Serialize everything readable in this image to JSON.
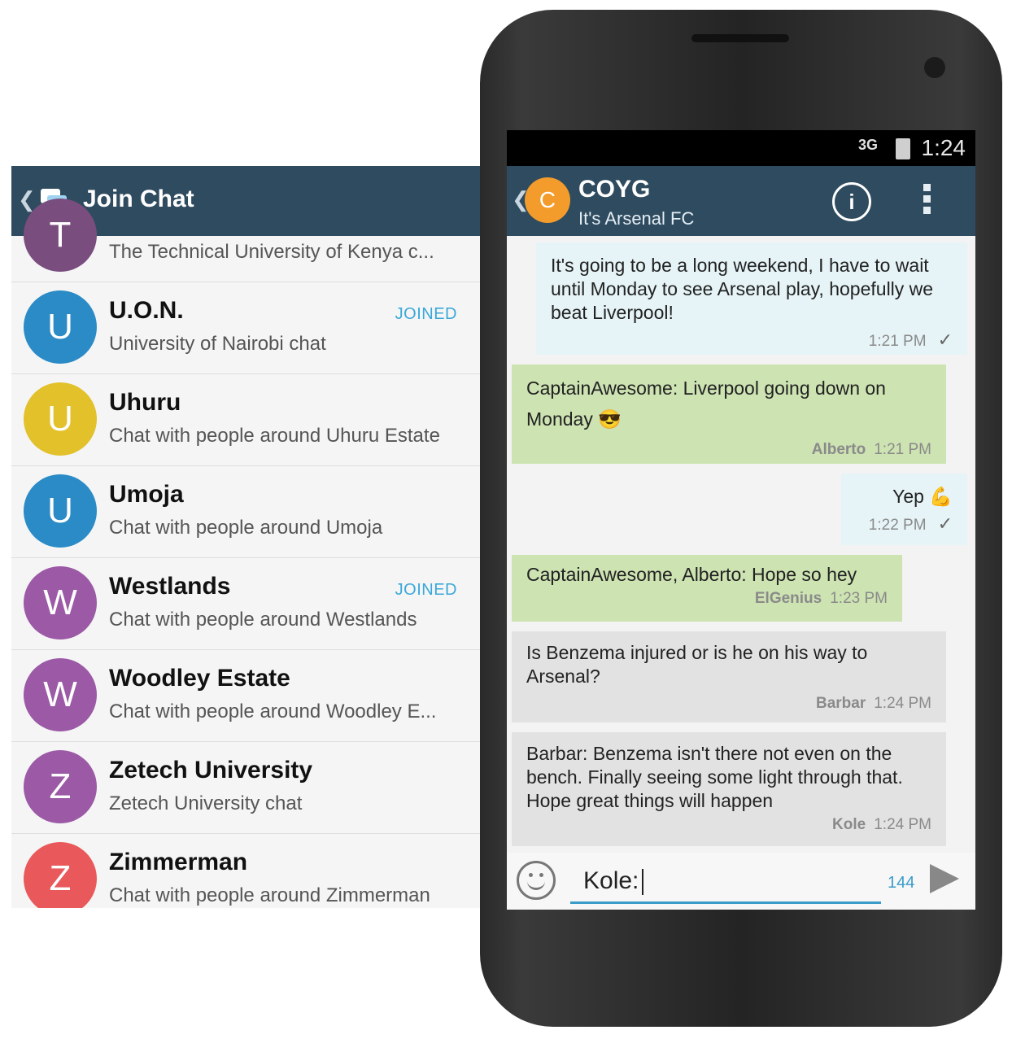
{
  "left": {
    "title": "Join Chat",
    "items": [
      {
        "avatar": "T",
        "name": "",
        "desc": "The Technical University of Kenya c...",
        "badge": "",
        "color": "#7a4d7f"
      },
      {
        "avatar": "U",
        "name": "U.O.N.",
        "desc": "University of Nairobi chat",
        "badge": "JOINED",
        "color": "#2a8bc6"
      },
      {
        "avatar": "U",
        "name": "Uhuru",
        "desc": "Chat with people around Uhuru Estate",
        "badge": "",
        "color": "#e2c12b"
      },
      {
        "avatar": "U",
        "name": "Umoja",
        "desc": "Chat with people around Umoja",
        "badge": "",
        "color": "#2a8bc6"
      },
      {
        "avatar": "W",
        "name": "Westlands",
        "desc": "Chat with people around Westlands",
        "badge": "JOINED",
        "color": "#9b59a6"
      },
      {
        "avatar": "W",
        "name": "Woodley Estate",
        "desc": "Chat with people around Woodley E...",
        "badge": "",
        "color": "#9b59a6"
      },
      {
        "avatar": "Z",
        "name": "Zetech University",
        "desc": "Zetech University chat",
        "badge": "",
        "color": "#9b59a6"
      },
      {
        "avatar": "Z",
        "name": "Zimmerman",
        "desc": "Chat with people around Zimmerman",
        "badge": "",
        "color": "#e9595c"
      }
    ]
  },
  "phone": {
    "status": {
      "network": "3G",
      "time": "1:24"
    },
    "header": {
      "avatar": "C",
      "title": "COYG",
      "subtitle": "It's Arsenal FC",
      "info": "i"
    },
    "messages": [
      {
        "text": "It's going to be a long weekend, I have to wait until Monday to see Arsenal play, hopefully we beat Liverpool!",
        "sender": "",
        "time": "1:21 PM",
        "check": "✓"
      },
      {
        "text": "CaptainAwesome: Liverpool going down on Monday 😎",
        "sender": "Alberto",
        "time": "1:21 PM",
        "check": ""
      },
      {
        "text": "Yep 💪",
        "sender": "",
        "time": "1:22 PM",
        "check": "✓"
      },
      {
        "text": "CaptainAwesome, Alberto: Hope so hey",
        "sender": "ElGenius",
        "time": "1:23 PM",
        "check": ""
      },
      {
        "text": "Is Benzema injured or is he on his way to Arsenal?",
        "sender": "Barbar",
        "time": "1:24 PM",
        "check": ""
      },
      {
        "text": "Barbar: Benzema isn't there not even on the bench. Finally seeing some light through that. Hope great things will happen",
        "sender": "Kole",
        "time": "1:24 PM",
        "check": ""
      }
    ],
    "composer": {
      "value": "Kole:",
      "count": "144"
    }
  }
}
